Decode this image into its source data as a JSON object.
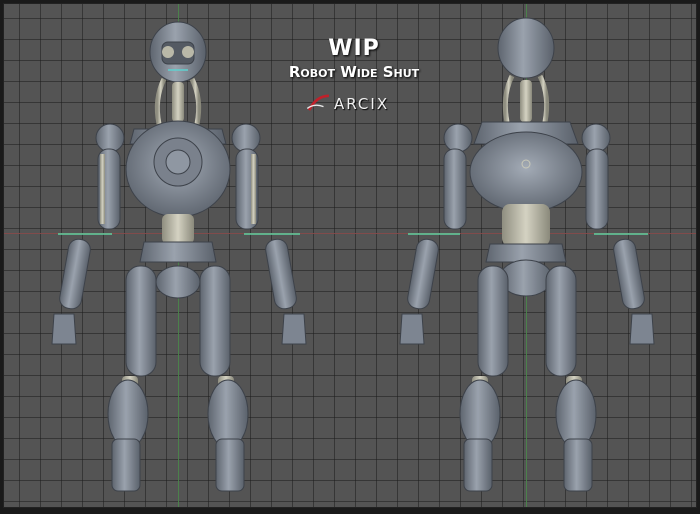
{
  "title": "WIP",
  "subtitle": "Robot Wide Shut",
  "logo_text": "ARCIX",
  "colors": {
    "background": "#545454",
    "grid": "#3a3a3a",
    "x_axis": "#8a4a4a",
    "y_axis": "#4a8a4a",
    "robot_body": "#7d8591",
    "robot_joint": "#b9b8a8",
    "logo_accent": "#c0202a"
  }
}
